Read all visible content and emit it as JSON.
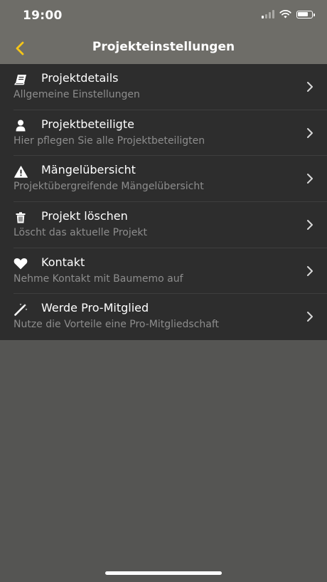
{
  "status_bar": {
    "time": "19:00"
  },
  "nav": {
    "title": "Projekteinstellungen",
    "back_icon": "chevron-left-icon",
    "accent_color": "#f5c518"
  },
  "menu": {
    "items": [
      {
        "icon": "book-icon",
        "title": "Projektdetails",
        "subtitle": "Allgemeine Einstellungen"
      },
      {
        "icon": "user-icon",
        "title": "Projektbeteiligte",
        "subtitle": "Hier pflegen Sie alle Projektbeteiligten"
      },
      {
        "icon": "warning-icon",
        "title": "Mängelübersicht",
        "subtitle": "Projektübergreifende Mängelübersicht"
      },
      {
        "icon": "trash-icon",
        "title": "Projekt löschen",
        "subtitle": "Löscht das aktuelle Projekt"
      },
      {
        "icon": "heart-icon",
        "title": "Kontakt",
        "subtitle": "Nehme Kontakt mit Baumemo auf"
      },
      {
        "icon": "magic-wand-icon",
        "title": "Werde Pro-Mitglied",
        "subtitle": "Nutze die Vorteile eine Pro-Mitgliedschaft"
      }
    ]
  }
}
